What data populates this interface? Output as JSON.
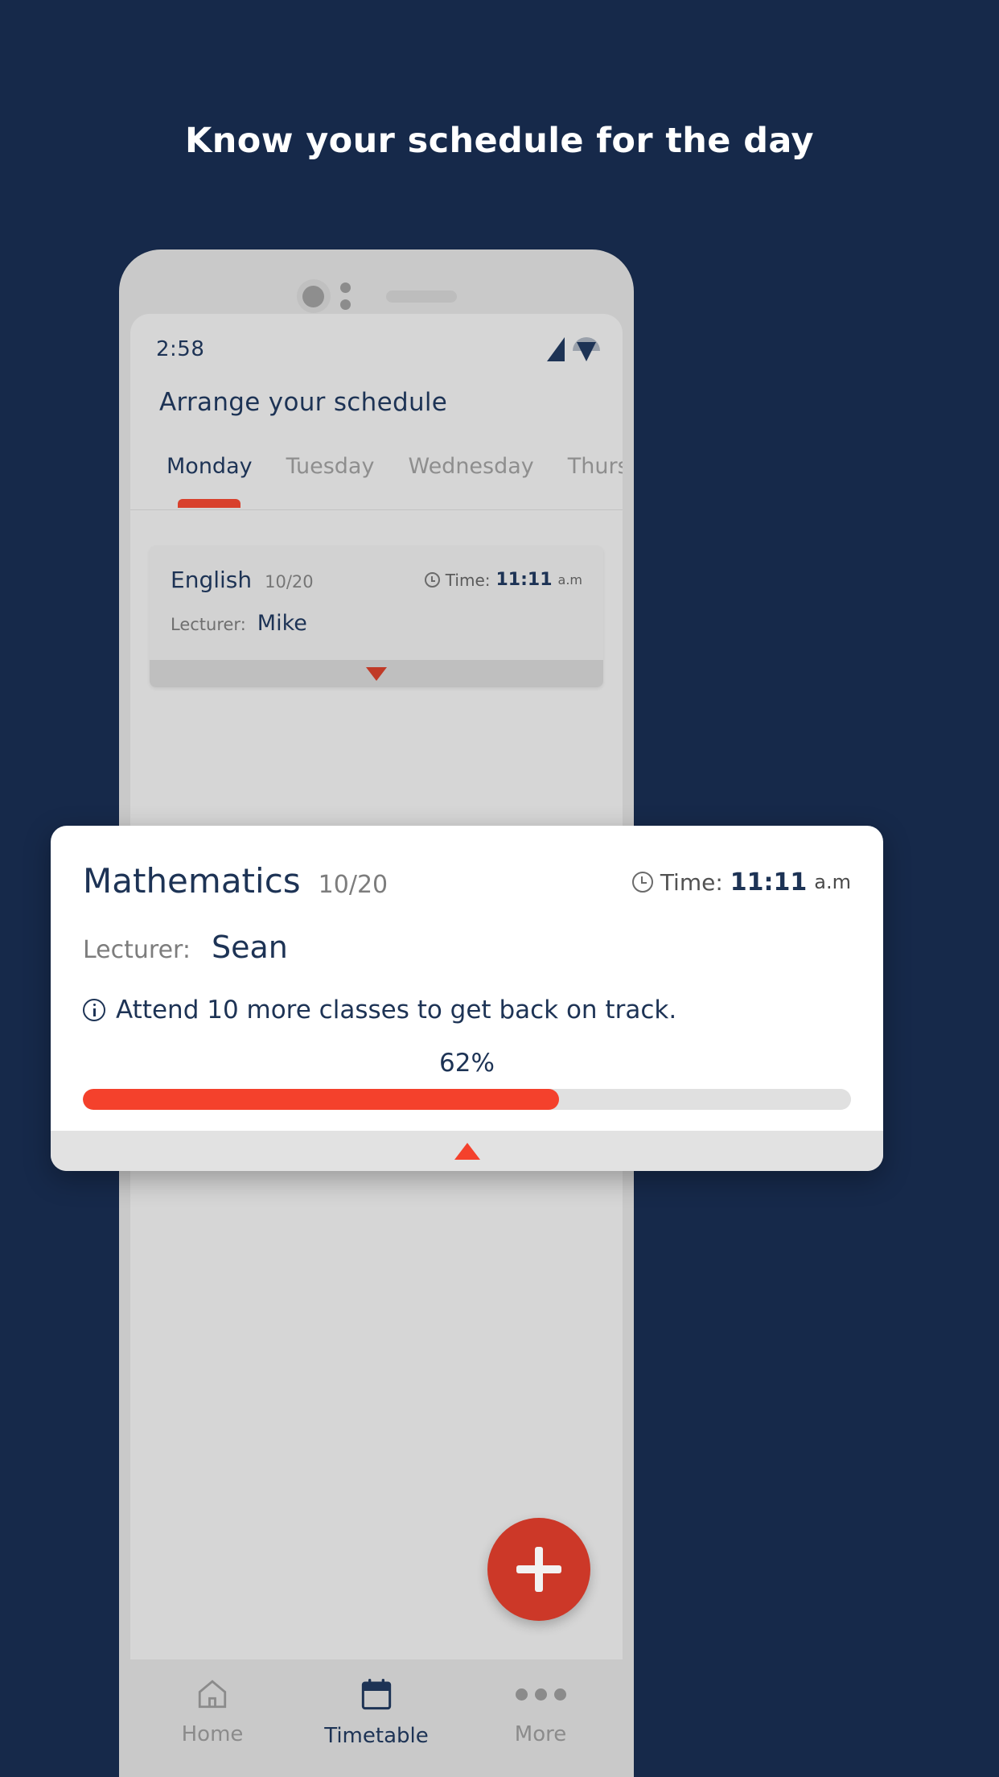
{
  "headline": "Know your schedule for the day",
  "colors": {
    "background": "#16294a",
    "accent_red": "#f4412c",
    "navy_text": "#1d3355",
    "phone_frame": "#c9c9c9",
    "phone_screen": "#d6d6d6"
  },
  "phone": {
    "statusbar": {
      "time": "2:58",
      "signal_icon": "cellular-signal-icon",
      "wifi_icon": "wifi-icon"
    },
    "app_title": "Arrange your schedule",
    "tabs": [
      {
        "label": "Monday",
        "active": true
      },
      {
        "label": "Tuesday",
        "active": false
      },
      {
        "label": "Wednesday",
        "active": false
      },
      {
        "label": "Thursday",
        "active": false
      }
    ],
    "class_card": {
      "subject": "English",
      "fraction": "10/20",
      "time_label": "Time:",
      "time_value": "11:11",
      "time_ampm": "a.m",
      "lecturer_label": "Lecturer:",
      "lecturer_name": "Mike",
      "expand_icon": "chevron-down-triangle-icon"
    },
    "fab": {
      "icon": "plus-icon",
      "color": "#cc3828"
    },
    "bottom_nav": [
      {
        "label": "Home",
        "icon": "home-icon",
        "active": false
      },
      {
        "label": "Timetable",
        "icon": "calendar-icon",
        "active": true
      },
      {
        "label": "More",
        "icon": "more-dots-icon",
        "active": false
      }
    ]
  },
  "popup": {
    "subject": "Mathematics",
    "fraction": "10/20",
    "time_label": "Time:",
    "time_value": "11:11",
    "time_ampm": "a.m",
    "lecturer_label": "Lecturer:",
    "lecturer_name": "Sean",
    "note_icon": "info-icon",
    "note": "Attend 10 more classes to get back on track.",
    "progress_percent_label": "62%",
    "progress_value": 62,
    "collapse_icon": "chevron-up-triangle-icon"
  }
}
